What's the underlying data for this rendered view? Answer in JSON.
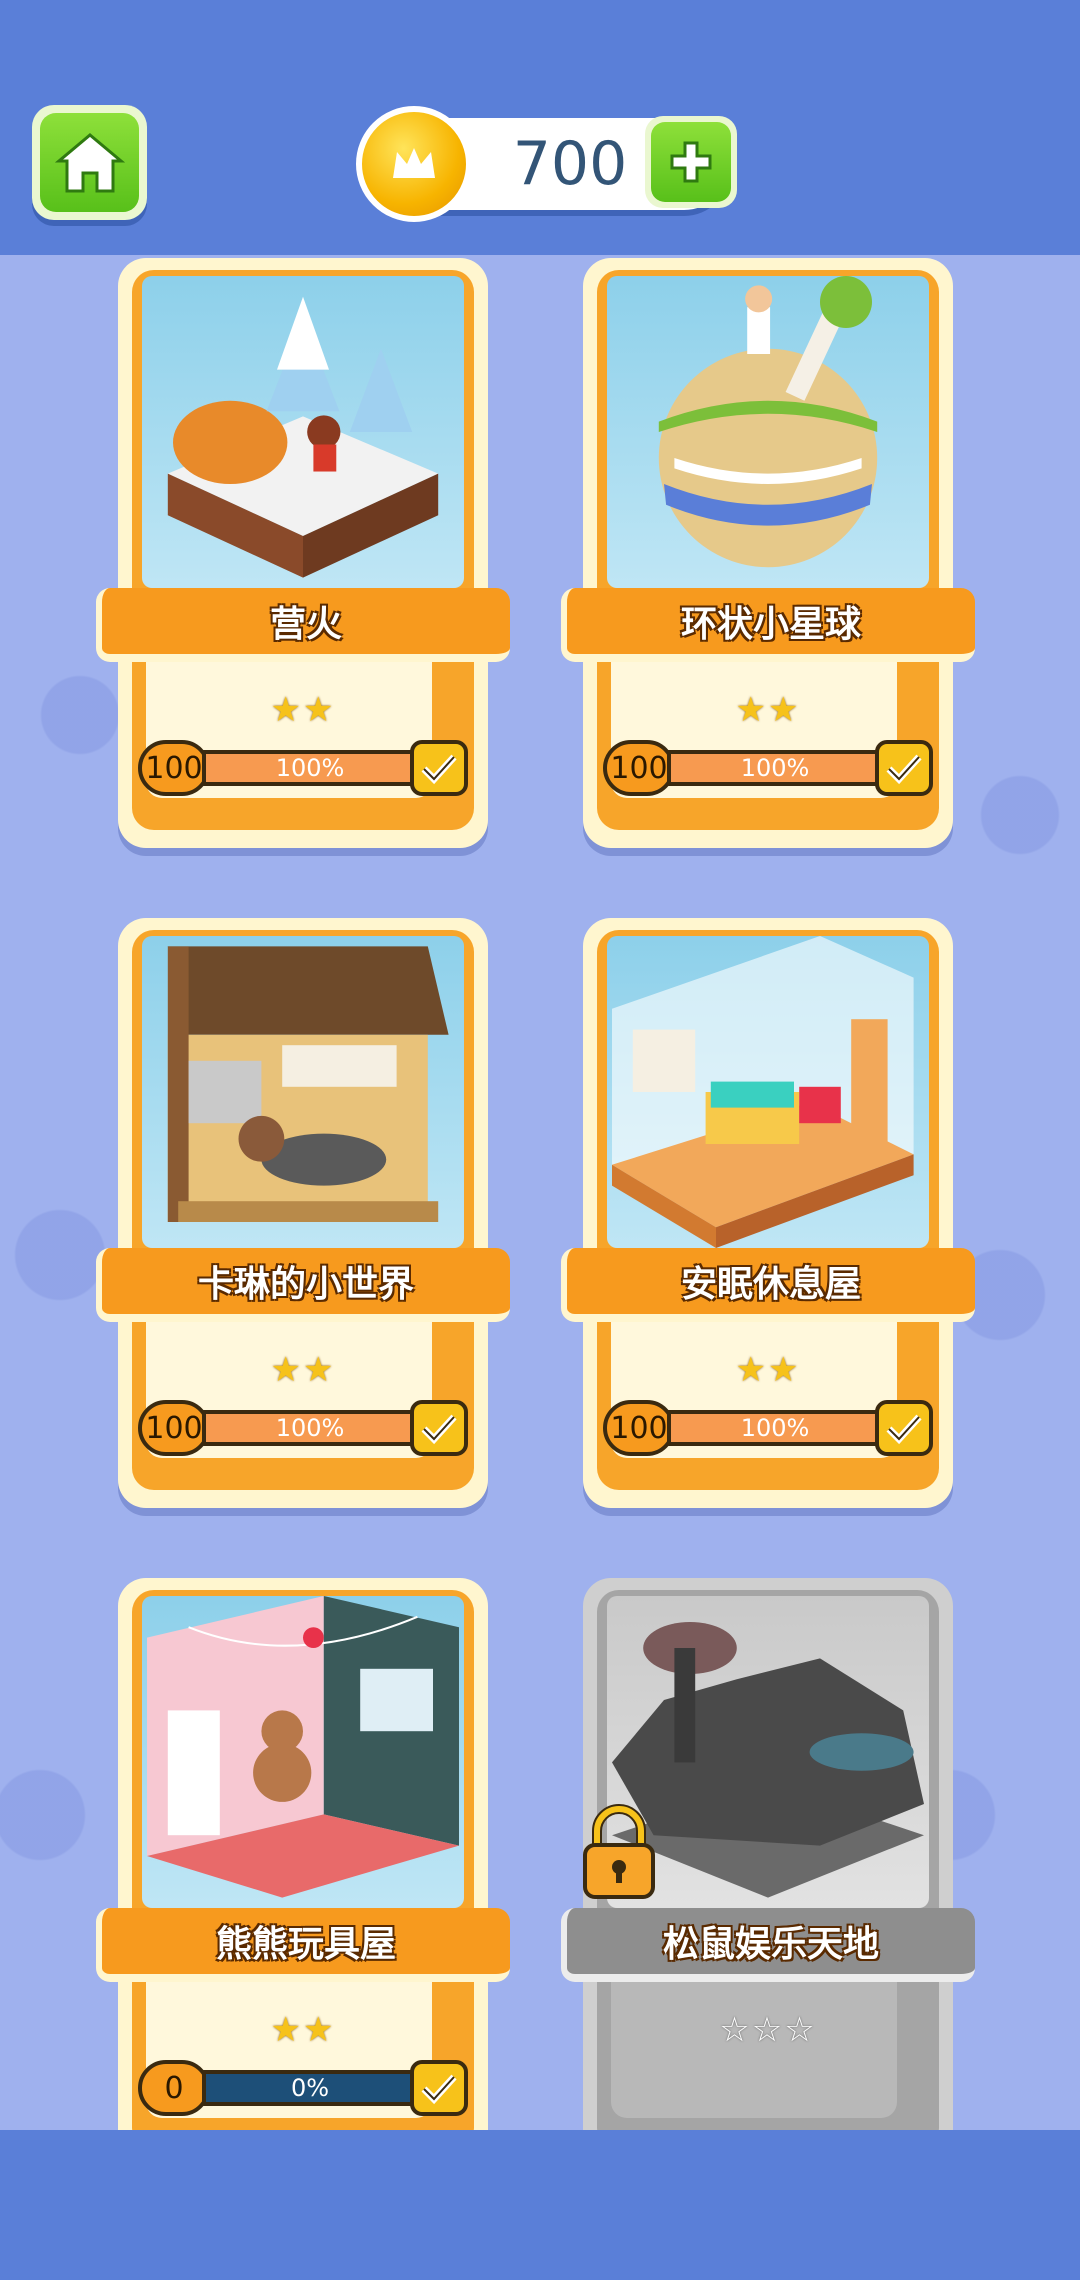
{
  "header": {
    "coins": "700"
  },
  "levels": [
    {
      "title": "营火",
      "stars": "★★",
      "count": "100",
      "progress_text": "100%",
      "progress": 1.0,
      "locked": false
    },
    {
      "title": "环状小星球",
      "stars": "★★",
      "count": "100",
      "progress_text": "100%",
      "progress": 1.0,
      "locked": false
    },
    {
      "title": "卡琳的小世界",
      "stars": "★★",
      "count": "100",
      "progress_text": "100%",
      "progress": 1.0,
      "locked": false
    },
    {
      "title": "安眠休息屋",
      "stars": "★★",
      "count": "100",
      "progress_text": "100%",
      "progress": 1.0,
      "locked": false
    },
    {
      "title": "熊熊玩具屋",
      "stars": "★★",
      "count": "0",
      "progress_text": "0%",
      "progress": 0.0,
      "locked": false
    },
    {
      "title": "松鼠娱乐天地",
      "stars": "☆☆☆",
      "count": "",
      "progress_text": "",
      "progress": 0.0,
      "locked": true
    }
  ],
  "colors": {
    "accent_orange": "#f79a1e",
    "topbar_blue": "#5a7fd8",
    "button_green": "#58c01a"
  }
}
